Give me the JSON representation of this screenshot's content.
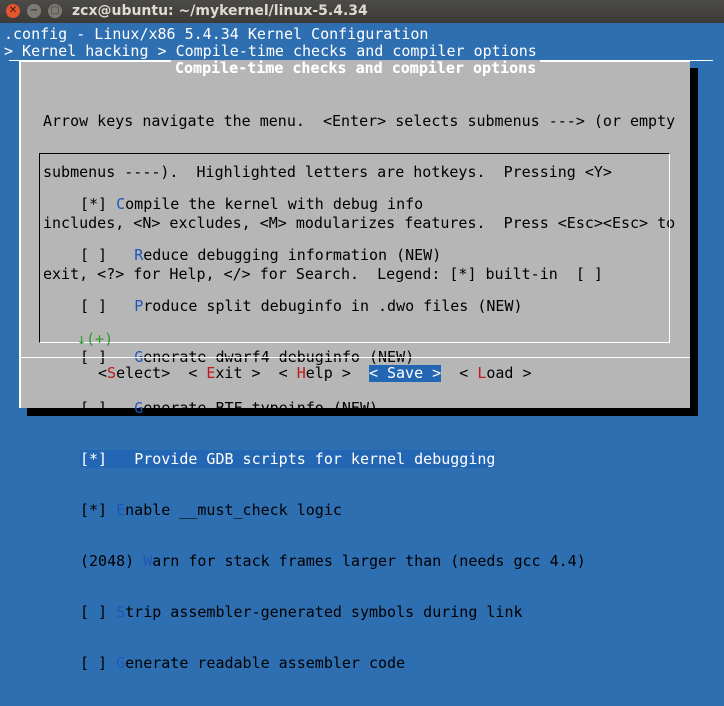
{
  "window": {
    "title": "zcx@ubuntu: ~/mykernel/linux-5.4.34",
    "close_glyph": "✕",
    "min_glyph": "−",
    "max_glyph": "▢"
  },
  "header": {
    "config_line": ".config - Linux/x86 5.4.34 Kernel Configuration",
    "breadcrumb": "> Kernel hacking > Compile-time checks and compiler options"
  },
  "dialog": {
    "title": "Compile-time checks and compiler options",
    "help_lines": [
      "Arrow keys navigate the menu.  <Enter> selects submenus ---> (or empty",
      "submenus ----).  Highlighted letters are hotkeys.  Pressing <Y>",
      "includes, <N> excludes, <M> modularizes features.  Press <Esc><Esc> to",
      "exit, <?> for Help, </> for Search.  Legend: [*] built-in  [ ]"
    ]
  },
  "menu": {
    "items": [
      {
        "prefix": "[*] ",
        "hotkey": "C",
        "rest": "ompile the kernel with debug info",
        "selected": false
      },
      {
        "prefix": "[ ]   ",
        "hotkey": "R",
        "rest": "educe debugging information (NEW)",
        "selected": false
      },
      {
        "prefix": "[ ]   ",
        "hotkey": "P",
        "rest": "roduce split debuginfo in .dwo files (NEW)",
        "selected": false
      },
      {
        "prefix": "[ ]   ",
        "hotkey": "G",
        "rest": "enerate dwarf4 debuginfo (NEW)",
        "selected": false
      },
      {
        "prefix": "[ ]   ",
        "hotkey": "G",
        "rest": "enerate BTF typeinfo (NEW)",
        "selected": false
      },
      {
        "prefix": "[*]   ",
        "hotkey": "P",
        "rest": "rovide GDB scripts for kernel debugging",
        "selected": true
      },
      {
        "prefix": "[*] ",
        "hotkey": "E",
        "rest": "nable __must_check logic",
        "selected": false
      },
      {
        "prefix": "(2048) ",
        "hotkey": "W",
        "rest": "arn for stack frames larger than (needs gcc 4.4)",
        "selected": false
      },
      {
        "prefix": "[ ] ",
        "hotkey": "S",
        "rest": "trip assembler-generated symbols during link",
        "selected": false
      },
      {
        "prefix": "[ ] ",
        "hotkey": "G",
        "rest": "enerate readable assembler code",
        "selected": false
      }
    ],
    "more_indicator": "↓(+)"
  },
  "buttons": {
    "select": {
      "left": "<",
      "hotkey": "S",
      "rest": "elect",
      "right": ">"
    },
    "exit": {
      "left": "< ",
      "hotkey": "E",
      "rest": "xit",
      "right": " >"
    },
    "help": {
      "left": "< ",
      "hotkey": "H",
      "rest": "elp",
      "right": " >"
    },
    "save": {
      "left": "< ",
      "hotkey": "S",
      "rest": "ave",
      "right": " >"
    },
    "load": {
      "left": "< ",
      "hotkey": "L",
      "rest": "oad",
      "right": " >"
    }
  },
  "colors": {
    "background": "#2e6fb2",
    "dialog": "#b6b6b6",
    "highlight": "#2366b3",
    "hotkey_menu": "#1f57b8",
    "hotkey_button": "#c01818",
    "more_indicator": "#2f9c2f"
  }
}
